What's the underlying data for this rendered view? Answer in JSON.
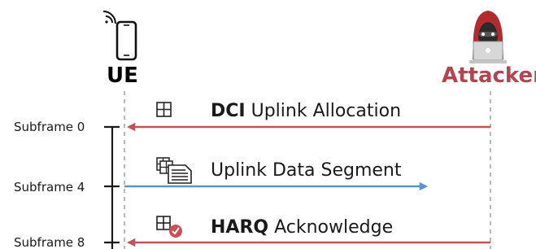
{
  "actors": {
    "ue": {
      "label": "UE",
      "icon": "smartphone-icon",
      "color": "#000000"
    },
    "attacker": {
      "label": "Attacker",
      "icon": "hooded-hacker-laptop-icon",
      "color": "#b0464f"
    }
  },
  "timeline": {
    "subframes": [
      "Subframe 0",
      "Subframe 4",
      "Subframe 8"
    ]
  },
  "messages": [
    {
      "bold": "DCI",
      "text": "Uplink Allocation",
      "direction": "attacker-to-ue",
      "color": "#c0545c",
      "icon": "grid-icon"
    },
    {
      "bold": "",
      "text": "Uplink Data Segment",
      "direction": "ue-to-attacker",
      "color": "#5b94c4",
      "icon": "grid-document-icon"
    },
    {
      "bold": "HARQ",
      "text": "Acknowledge",
      "direction": "attacker-to-ue",
      "color": "#c0545c",
      "icon": "grid-check-icon"
    }
  ],
  "colors": {
    "attack_red": "#c0545c",
    "uplink_blue": "#5b94c4",
    "check_badge": "#cf4d55",
    "lifeline_gray": "#b8b8b8"
  }
}
